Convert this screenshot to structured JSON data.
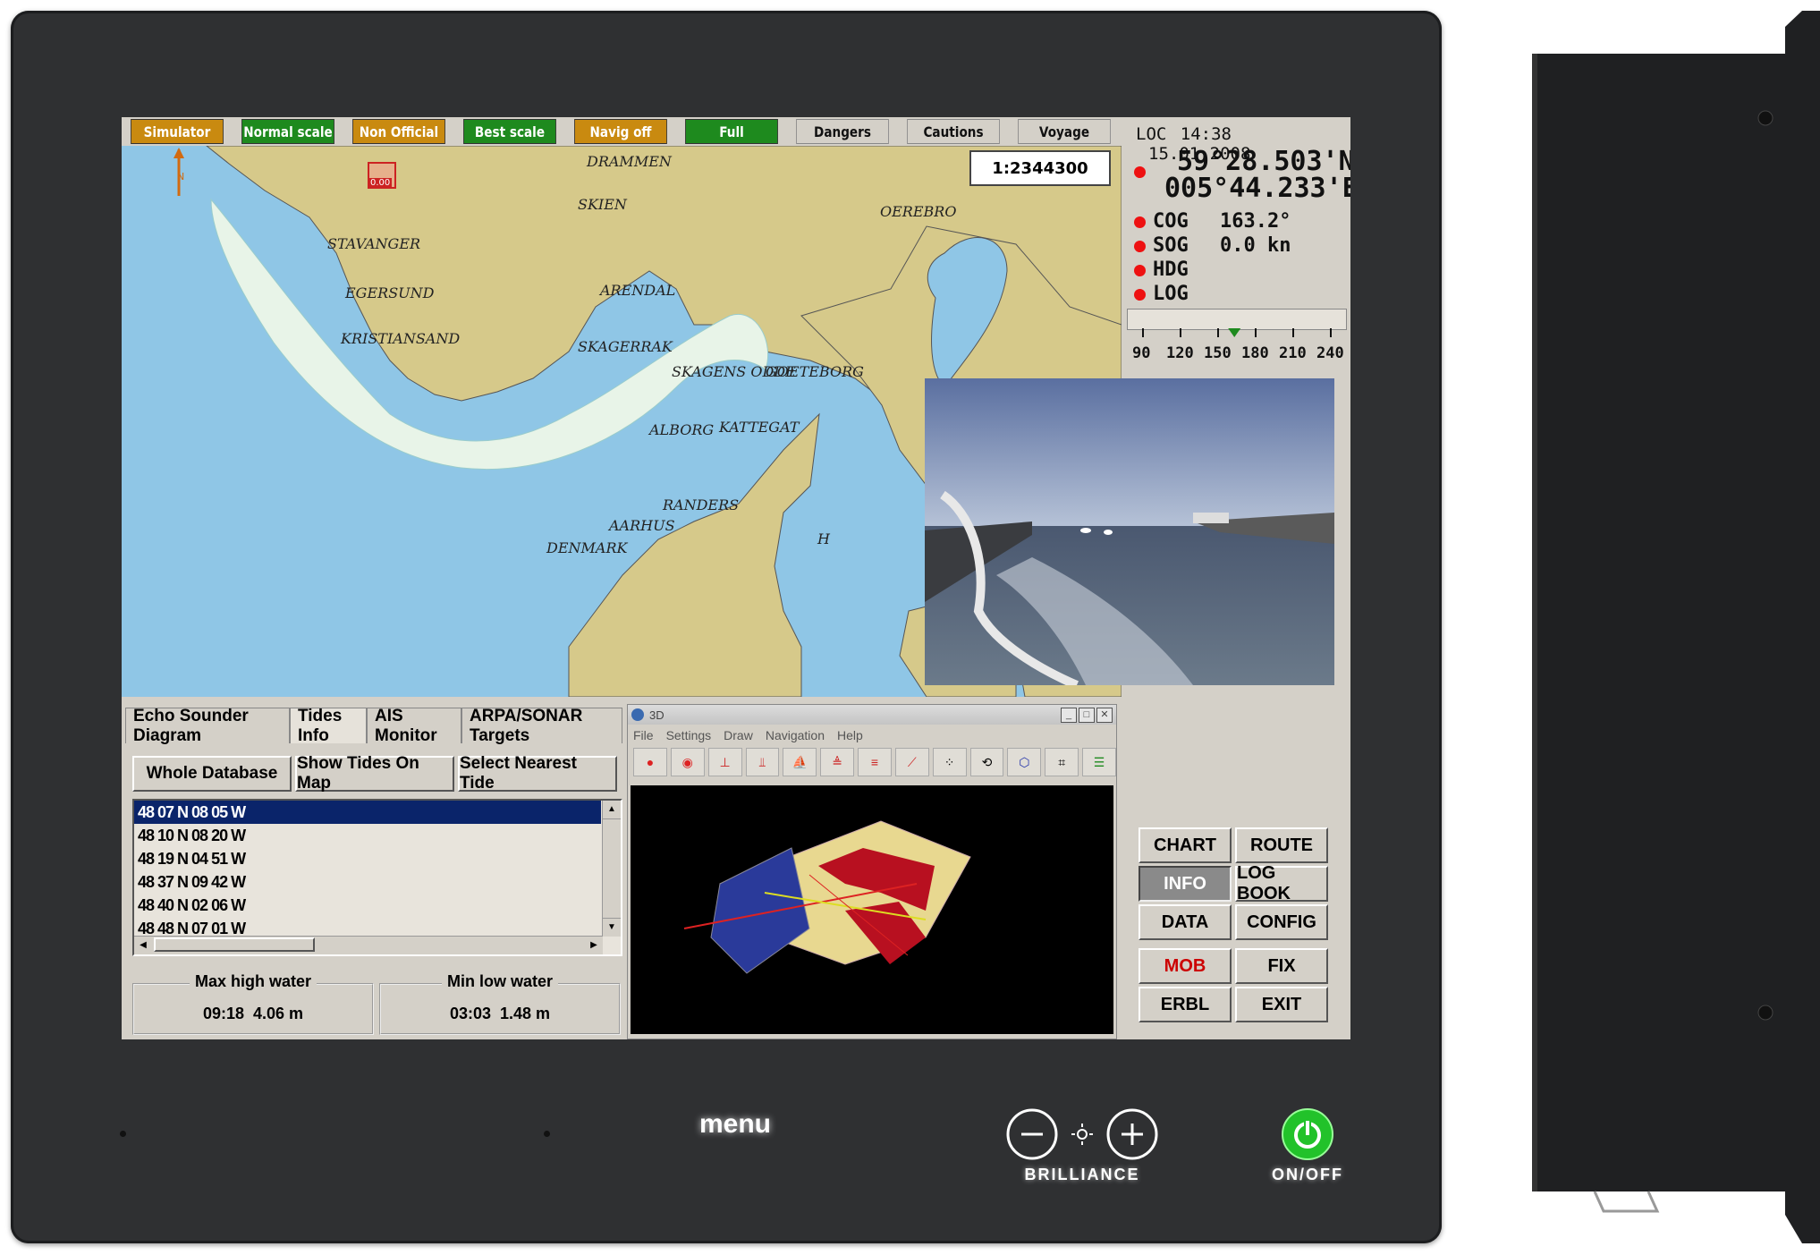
{
  "status_bar": [
    {
      "label": "Simulator",
      "color": "orange"
    },
    {
      "label": "Normal scale",
      "color": "green"
    },
    {
      "label": "Non Official",
      "color": "orange"
    },
    {
      "label": "Best scale",
      "color": "green"
    },
    {
      "label": "Navig off",
      "color": "orange"
    },
    {
      "label": "Full",
      "color": "green"
    },
    {
      "label": "Dangers",
      "color": "gray"
    },
    {
      "label": "Cautions",
      "color": "gray"
    },
    {
      "label": "Voyage",
      "color": "gray"
    }
  ],
  "chart": {
    "scale": "1:2344300",
    "own_ship_label": "0.00",
    "places": [
      "DRAMMEN",
      "SKIEN",
      "OEREBRO",
      "STAVANGER",
      "EGERSUND",
      "ARENDAL",
      "KRISTIANSAND",
      "SKAGERRAK",
      "SKAGENS ODDE",
      "GOETEBORG",
      "ALBORG",
      "KATTEGAT",
      "RANDERS",
      "AARHUS",
      "DENMARK",
      "H"
    ]
  },
  "nav_info": {
    "loc_label": "LOC",
    "time": "14:38",
    "date": "15.01.2008",
    "lat": "59°28.503'N",
    "lon": "005°44.233'E",
    "cog_label": "COG",
    "cog_value": "163.2°",
    "sog_label": "SOG",
    "sog_value": "0.0 kn",
    "hdg_label": "HDG",
    "log_label": "LOG",
    "compass_ticks": [
      "90",
      "120",
      "150",
      "180",
      "210",
      "240"
    ],
    "heading_marker_deg": 163
  },
  "tabs": [
    "Echo Sounder Diagram",
    "Tides Info",
    "AIS Monitor",
    "ARPA/SONAR Targets"
  ],
  "tide_buttons": [
    "Whole Database",
    "Show Tides On Map",
    "Select Nearest Tide"
  ],
  "tide_list": [
    "48 07 N 08 05 W",
    "48 10 N 08 20 W",
    "48 19 N 04 51 W",
    "48 37 N 09 42 W",
    "48 40 N 02 06 W",
    "48 48 N 07 01 W"
  ],
  "tide_summary": {
    "max_label": "Max high water",
    "max_value": "09:18  4.06 m",
    "min_label": "Min low water",
    "min_value": "03:03  1.48 m"
  },
  "window3d": {
    "title": "3D",
    "menu": [
      "File",
      "Settings",
      "Draw",
      "Navigation",
      "Help"
    ]
  },
  "nav_buttons": [
    {
      "label": "CHART"
    },
    {
      "label": "ROUTE"
    },
    {
      "label": "INFO"
    },
    {
      "label": "LOG BOOK"
    },
    {
      "label": "DATA"
    },
    {
      "label": "CONFIG"
    },
    {
      "label": "MOB"
    },
    {
      "label": "FIX"
    },
    {
      "label": "ERBL"
    },
    {
      "label": "EXIT"
    }
  ],
  "hardware": {
    "menu": "menu",
    "brilliance": "BRILLIANCE",
    "power": "ON/OFF"
  },
  "colors": {
    "bezel": "#2f3032",
    "status_orange": "#c98a10",
    "status_green": "#1e8a1e",
    "sea": "#8fc6e6",
    "land": "#d6c98a",
    "power_green": "#22c22a"
  }
}
